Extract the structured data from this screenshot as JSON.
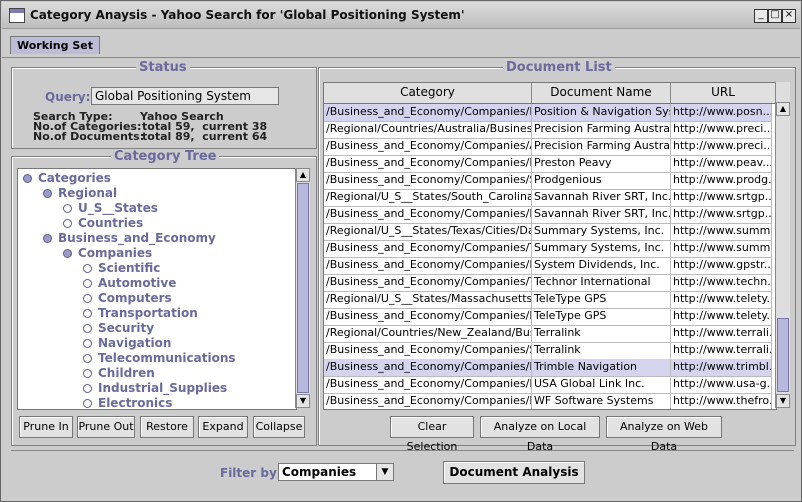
{
  "window": {
    "title": "Category Anaysis - Yahoo Search for 'Global Positioning System'"
  },
  "tabs": [
    {
      "label": "Working Set"
    }
  ],
  "status": {
    "title": "Status",
    "query_label": "Query:",
    "query_value": "Global Positioning System",
    "search_type_label": "Search Type:",
    "search_type_value": "Yahoo Search",
    "categories_label": "No.of Categories:",
    "categories_value": "total 59,  current 38",
    "documents_label": "No.of Documents:",
    "documents_value": "total 89,  current 64"
  },
  "category_tree": {
    "title": "Category Tree",
    "items": [
      {
        "label": "Categories",
        "level": 0,
        "state": "fill"
      },
      {
        "label": "Regional",
        "level": 1,
        "state": "fill"
      },
      {
        "label": "U_S__States",
        "level": 2,
        "state": "open"
      },
      {
        "label": "Countries",
        "level": 2,
        "state": "open"
      },
      {
        "label": "Business_and_Economy",
        "level": 1,
        "state": "fill"
      },
      {
        "label": "Companies",
        "level": 2,
        "state": "fill"
      },
      {
        "label": "Scientific",
        "level": 3,
        "state": "open"
      },
      {
        "label": "Automotive",
        "level": 3,
        "state": "open"
      },
      {
        "label": "Computers",
        "level": 3,
        "state": "open"
      },
      {
        "label": "Transportation",
        "level": 3,
        "state": "open"
      },
      {
        "label": "Security",
        "level": 3,
        "state": "open"
      },
      {
        "label": "Navigation",
        "level": 3,
        "state": "open"
      },
      {
        "label": "Telecommunications",
        "level": 3,
        "state": "open"
      },
      {
        "label": "Children",
        "level": 3,
        "state": "open"
      },
      {
        "label": "Industrial_Supplies",
        "level": 3,
        "state": "open"
      },
      {
        "label": "Electronics",
        "level": 3,
        "state": "open"
      }
    ],
    "buttons": {
      "prune_in": "Prune In",
      "prune_out": "Prune Out",
      "restore": "Restore",
      "expand": "Expand",
      "collapse": "Collapse"
    }
  },
  "document_list": {
    "title": "Document List",
    "columns": [
      "Category",
      "Document Name",
      "URL"
    ],
    "rows": [
      {
        "category": "/Business_and_Economy/Companies/Na...",
        "name": "Position & Navigation Syst...",
        "url": "http://www.posn...",
        "selected": true
      },
      {
        "category": "/Regional/Countries/Australia/Business_...",
        "name": "Precision Farming Australia",
        "url": "http://www.preci..."
      },
      {
        "category": "/Business_and_Economy/Companies/A...",
        "name": "Precision Farming Australia",
        "url": "http://www.preci..."
      },
      {
        "category": "/Business_and_Economy/Companies/Na...",
        "name": "Preston Peavy",
        "url": "http://www.peav..."
      },
      {
        "category": "/Business_and_Economy/Companies/Se...",
        "name": "Prodgenious",
        "url": "http://www.prodg..."
      },
      {
        "category": "/Regional/U_S__States/South_Carolina/...",
        "name": "Savannah River SRT, Inc.",
        "url": "http://www.srtgp..."
      },
      {
        "category": "/Business_and_Economy/Companies/Na...",
        "name": "Savannah River SRT, Inc.",
        "url": "http://www.srtgp..."
      },
      {
        "category": "/Regional/U_S__States/Texas/Cities/Dall...",
        "name": "Summary Systems, Inc.",
        "url": "http://www.summ..."
      },
      {
        "category": "/Business_and_Economy/Companies/Tr...",
        "name": "Summary Systems, Inc.",
        "url": "http://www.summ..."
      },
      {
        "category": "/Business_and_Economy/Companies/Na...",
        "name": "System Dividends, Inc.",
        "url": "http://www.gpstr..."
      },
      {
        "category": "/Business_and_Economy/Companies/Te...",
        "name": "Technor International",
        "url": "http://www.techn..."
      },
      {
        "category": "/Regional/U_S__States/Massachusetts/...",
        "name": "TeleType GPS",
        "url": "http://www.telety..."
      },
      {
        "category": "/Business_and_Economy/Companies/Na...",
        "name": "TeleType GPS",
        "url": "http://www.telety..."
      },
      {
        "category": "/Regional/Countries/New_Zealand/Busin...",
        "name": "Terralink",
        "url": "http://www.terrali..."
      },
      {
        "category": "/Business_and_Economy/Companies/Sc...",
        "name": "Terralink",
        "url": "http://www.terrali..."
      },
      {
        "category": "/Business_and_Economy/Companies/Na...",
        "name": "Trimble Navigation",
        "url": "http://www.trimbl...",
        "selected": true
      },
      {
        "category": "/Business_and_Economy/Companies/El...",
        "name": "USA Global Link Inc.",
        "url": "http://www.usa-g..."
      },
      {
        "category": "/Business_and_Economy/Companies/Na...",
        "name": "WF Software Systems",
        "url": "http://www.thefro..."
      }
    ],
    "buttons": {
      "clear": "Clear Selection",
      "local": "Analyze on Local Data",
      "web": "Analyze on Web Data"
    }
  },
  "footer": {
    "filter_label": "Filter by:",
    "filter_value": "Companies",
    "analysis_button": "Document Analysis"
  },
  "colors": {
    "accent": "#6a6a9c",
    "selection": "#d4d4ee",
    "thumb": "#b8b8dc"
  }
}
